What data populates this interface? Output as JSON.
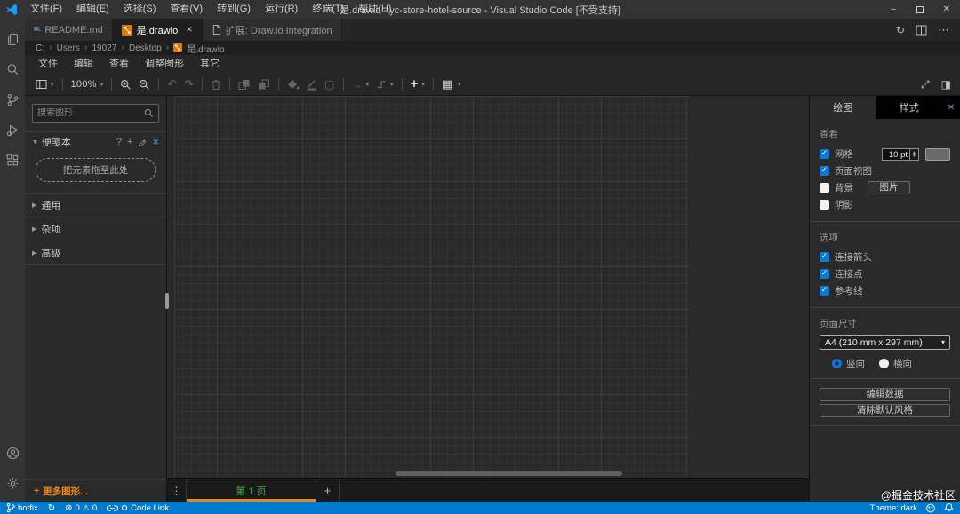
{
  "titlebar": {
    "title": "是.drawio - yc-store-hotel-source - Visual Studio Code [不受支持]",
    "menus": [
      "文件(F)",
      "编辑(E)",
      "选择(S)",
      "查看(V)",
      "转到(G)",
      "运行(R)",
      "终端(T)",
      "帮助(H)"
    ]
  },
  "activity_bar": {
    "icons": [
      "explorer",
      "search",
      "source-control",
      "run-and-debug",
      "extensions",
      "account",
      "settings"
    ]
  },
  "editor_tabs": {
    "tabs": [
      {
        "label": "README.md",
        "active": false
      },
      {
        "label": "是.drawio",
        "active": true
      },
      {
        "label": "扩展: Draw.io Integration",
        "active": false
      }
    ],
    "action_icons": [
      "open-changes",
      "split-editor",
      "more-actions"
    ]
  },
  "breadcrumb": {
    "items": [
      "C:",
      "Users",
      "19027",
      "Desktop",
      "是.drawio"
    ]
  },
  "drawio": {
    "menubar": [
      "文件",
      "编辑",
      "查看",
      "调整图形",
      "其它"
    ],
    "toolbar": {
      "zoom_level": "100%",
      "icons": [
        "view-panels",
        "zoom-dropdown",
        "zoom-in",
        "zoom-out",
        "undo",
        "redo",
        "delete",
        "to-front",
        "to-back",
        "fill-color",
        "line-color",
        "shadow",
        "connection",
        "waypoints",
        "insert",
        "table",
        "fullscreen",
        "format-panel-toggle"
      ]
    },
    "shapes_panel": {
      "search_placeholder": "搜索图形",
      "scratchpad_title": "便笺本",
      "scratchpad_tools": [
        "help",
        "add",
        "edit",
        "close"
      ],
      "drop_hint": "把元素拖至此处",
      "sections": [
        "通用",
        "杂项",
        "高级"
      ],
      "more_shapes": "更多图形..."
    },
    "canvas": {
      "page_label": "第 1 页"
    },
    "format_panel": {
      "tabs": {
        "diagram": "绘图",
        "style": "样式",
        "diagram_active": true
      },
      "view": {
        "title": "查看",
        "grid": {
          "label": "网格",
          "checked": true,
          "size": "10 pt"
        },
        "page_view": {
          "label": "页面视图",
          "checked": true
        },
        "background": {
          "label": "背景",
          "checked": false,
          "image_button": "图片"
        },
        "shadow": {
          "label": "阴影",
          "checked": false
        }
      },
      "options": {
        "title": "选项",
        "items": [
          {
            "label": "连接箭头",
            "checked": true
          },
          {
            "label": "连接点",
            "checked": true
          },
          {
            "label": "参考线",
            "checked": true
          }
        ]
      },
      "page_size": {
        "title": "页面尺寸",
        "value": "A4 (210 mm x 297 mm)",
        "portrait": "竖向",
        "landscape": "横向",
        "portrait_selected": true
      },
      "buttons": {
        "edit_data": "编辑数据",
        "clear_default_style": "清除默认风格"
      }
    }
  },
  "status_bar": {
    "branch": "hotfix",
    "errors": "0",
    "warnings": "0",
    "codelink": "Code Link",
    "theme": "Theme: dark"
  },
  "watermark": "@掘金技术社区",
  "colors": {
    "accent_blue": "#007acc",
    "drawio_orange": "#ed8600",
    "checkbox_blue": "#1177d1",
    "page_tab_green": "#45ae4b",
    "grid_swatch": "#6a6a6a"
  }
}
